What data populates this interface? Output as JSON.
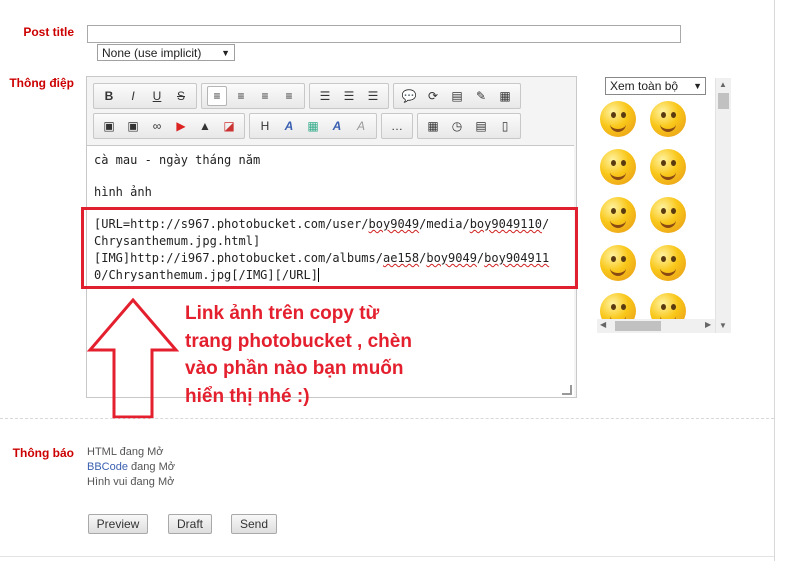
{
  "labels": {
    "post_title": "Post title",
    "message": "Thông điệp",
    "notices": "Thông báo"
  },
  "post_title_input": {
    "value": ""
  },
  "prefix_select": {
    "selected": "None (use implicit)"
  },
  "toolbar": {
    "row1": [
      [
        {
          "name": "bold-button",
          "glyph": "B"
        },
        {
          "name": "italic-button",
          "glyph": "I"
        },
        {
          "name": "underline-button",
          "glyph": "U"
        },
        {
          "name": "strikethrough-button",
          "glyph": "S"
        }
      ],
      [
        {
          "name": "align-left-button",
          "glyph": "≡",
          "active": true
        },
        {
          "name": "align-center-button",
          "glyph": "≡"
        },
        {
          "name": "align-right-button",
          "glyph": "≡"
        },
        {
          "name": "justify-button",
          "glyph": "≡"
        }
      ],
      [
        {
          "name": "bullet-list-button",
          "glyph": "☰"
        },
        {
          "name": "numbered-list-button",
          "glyph": "☰"
        },
        {
          "name": "horizontal-rule-button",
          "glyph": "☰"
        }
      ],
      [
        {
          "name": "quote-button",
          "glyph": "💬"
        },
        {
          "name": "code-button",
          "glyph": "⟳"
        },
        {
          "name": "note-button",
          "glyph": "▤"
        },
        {
          "name": "edit-button",
          "glyph": "✎"
        },
        {
          "name": "table-button",
          "glyph": "▦"
        }
      ]
    ],
    "row2": [
      [
        {
          "name": "image-button",
          "glyph": "▣"
        },
        {
          "name": "image-upload-button",
          "glyph": "▣"
        },
        {
          "name": "link-button",
          "glyph": "∞"
        },
        {
          "name": "youtube-button",
          "glyph": "▶"
        },
        {
          "name": "attach-button",
          "glyph": "▲"
        },
        {
          "name": "pdf-button",
          "glyph": "◪"
        }
      ],
      [
        {
          "name": "heading-button",
          "glyph": "H"
        },
        {
          "name": "font-size-button",
          "glyph": "A"
        },
        {
          "name": "color-button",
          "glyph": "▦"
        },
        {
          "name": "font-button",
          "glyph": "A"
        },
        {
          "name": "remove-format-button",
          "glyph": "A"
        }
      ],
      [
        {
          "name": "more-button",
          "glyph": "…"
        }
      ],
      [
        {
          "name": "calendar-button",
          "glyph": "▦"
        },
        {
          "name": "clock-button",
          "glyph": "◷"
        },
        {
          "name": "paste-button",
          "glyph": "▤"
        },
        {
          "name": "document-button",
          "glyph": "▯"
        }
      ]
    ]
  },
  "editor": {
    "line1": "cà mau - ngày tháng năm",
    "line2": "hình ảnh",
    "line3": [
      {
        "t": "[URL=http://s967.photobucket.com/user/"
      },
      {
        "t": "boy9049",
        "sq": true
      },
      {
        "t": "/media/"
      },
      {
        "t": "boy9049110",
        "sq": true
      },
      {
        "t": "/"
      }
    ],
    "line4": "Chrysanthemum.jpg.html]",
    "line5": [
      {
        "t": "[IMG]http://i967.photobucket.com/albums/"
      },
      {
        "t": "ae158",
        "sq": true
      },
      {
        "t": "/"
      },
      {
        "t": "boy9049",
        "sq": true
      },
      {
        "t": "/"
      },
      {
        "t": "boy904911",
        "sq": true
      }
    ],
    "line6": "0/Chrysanthemum.jpg[/IMG][/URL]"
  },
  "annotation": {
    "line1": "Link ảnh trên copy từ",
    "line2": "trang photobucket , chèn",
    "line3": "vào phần nào bạn muốn",
    "line4": "hiển thị nhé :)"
  },
  "smilies": {
    "filter_selected": "Xem toàn bộ",
    "items": [
      "smile",
      "laugh",
      "blush",
      "grin",
      "nervous",
      "angry",
      "wink",
      "big-grin",
      "dizzy",
      "cry"
    ]
  },
  "notices": {
    "html_label": "HTML",
    "html_status": "đang Mở",
    "bbcode_link": "BBCode",
    "bbcode_status": "đang Mở",
    "smilies_label": "Hình vui",
    "smilies_status": "đang Mở"
  },
  "buttons": {
    "preview": "Preview",
    "draft": "Draft",
    "send": "Send"
  },
  "colors": {
    "label_red": "#cc0000",
    "annotation_red": "#e41f2e",
    "link_blue": "#3a5fb0"
  }
}
